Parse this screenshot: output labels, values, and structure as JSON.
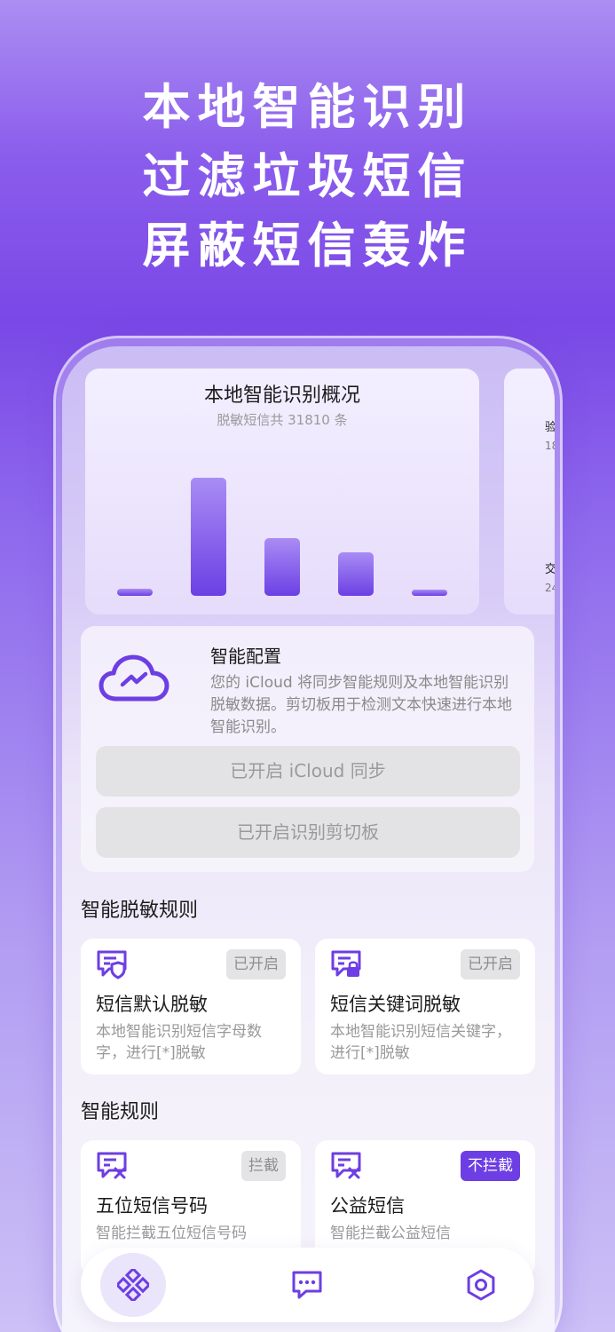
{
  "headline": {
    "line1": "本地智能识别",
    "line2": "过滤垃圾短信",
    "line3": "屏蔽短信轰炸"
  },
  "overview": {
    "title": "本地智能识别概况",
    "subtitle": "脱敏短信共 31810 条",
    "bar_levels": [
      0.06,
      1.0,
      0.49,
      0.37,
      0.04
    ],
    "bar_color_top": "#a98cf4",
    "bar_color_bottom": "#6c40e4",
    "next_card": {
      "label1": "验",
      "value1": "18",
      "label2": "交",
      "value2": "24"
    }
  },
  "config": {
    "icon": "cloud-icon",
    "title": "智能配置",
    "description": "您的 iCloud 将同步智能规则及本地智能识别脱敏数据。剪切板用于检测文本快速进行本地智能识别。",
    "icloud_button": "已开启 iCloud 同步",
    "clipboard_button": "已开启识别剪切板"
  },
  "desensitize_section": {
    "title": "智能脱敏规则",
    "rules": [
      {
        "icon": "message-shield-icon",
        "badge": "已开启",
        "name": "短信默认脱敏",
        "desc": "本地智能识别短信字母数字，进行[*]脱敏"
      },
      {
        "icon": "message-lock-icon",
        "badge": "已开启",
        "name": "短信关键词脱敏",
        "desc": "本地智能识别短信关键字，进行[*]脱敏"
      }
    ]
  },
  "smart_rules_section": {
    "title": "智能规则",
    "rules": [
      {
        "icon": "message-block-icon",
        "badge": "拦截",
        "name": "五位短信号码",
        "desc": "智能拦截五位短信号码"
      },
      {
        "icon": "message-block-icon",
        "badge": "不拦截",
        "name": "公益短信",
        "desc": "智能拦截公益短信"
      }
    ]
  },
  "tabbar": {
    "tabs": [
      {
        "icon": "diamond-grid-icon",
        "active": true
      },
      {
        "icon": "chat-bubble-icon",
        "active": false
      },
      {
        "icon": "gear-icon",
        "active": false
      }
    ]
  },
  "colors": {
    "accent": "#6d3ee3",
    "background_top": "#ab8ef2",
    "background_bottom": "#ccc0f6"
  }
}
